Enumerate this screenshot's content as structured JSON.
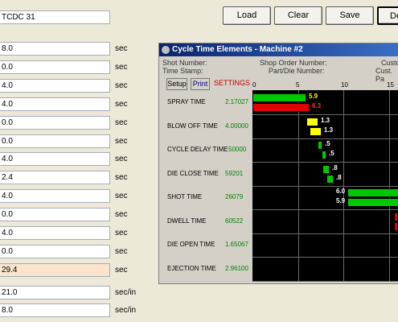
{
  "toolbar": {
    "id_value": "TCDC 31",
    "load_label": "Load",
    "clear_label": "Clear",
    "save_label": "Save",
    "partial_label": "De"
  },
  "fields": [
    {
      "value": "8.0",
      "unit": "sec"
    },
    {
      "value": "0.0",
      "unit": "sec"
    },
    {
      "value": "4.0",
      "unit": "sec"
    },
    {
      "value": "4.0",
      "unit": "sec"
    },
    {
      "value": "0.0",
      "unit": "sec"
    },
    {
      "value": "0.0",
      "unit": "sec"
    },
    {
      "value": "4.0",
      "unit": "sec"
    },
    {
      "value": "2.4",
      "unit": "sec"
    },
    {
      "value": "4.0",
      "unit": "sec"
    },
    {
      "value": "0.0",
      "unit": "sec"
    },
    {
      "value": "4.0",
      "unit": "sec"
    },
    {
      "value": "0.0",
      "unit": "sec"
    },
    {
      "value": "29.4",
      "unit": "sec"
    }
  ],
  "extra_fields": [
    {
      "value": "21.0",
      "unit": "sec/in"
    },
    {
      "value": "8.0",
      "unit": "sec/in"
    }
  ],
  "window": {
    "title": "Cycle Time Elements - Machine #2",
    "shot_number_label": "Shot Number:",
    "time_stamp_label": "Time Stamp:",
    "shop_order_label": "Shop Order Number:",
    "part_die_label": "Part/Die Number:",
    "custom_label": "Custon",
    "cust_part_label": "Cust. Pa",
    "setup_label": "Setup",
    "print_label": "Print",
    "settings_label": "SETTINGS"
  },
  "chart_data": {
    "type": "bar",
    "orientation": "horizontal-gantt",
    "x_ticks": [
      "0",
      "5",
      "10",
      "15"
    ],
    "xlim": [
      0,
      16
    ],
    "colors": {
      "green": "#00c800",
      "red": "#e00000",
      "yellow": "#ffff00"
    },
    "rows": [
      {
        "label": "SPRAY TIME",
        "value": "2.17027",
        "bars": [
          {
            "start": 0,
            "dur": 5.9,
            "color": "green",
            "label": "5.9",
            "label_color": "#ffff00"
          },
          {
            "start": 0,
            "dur": 6.3,
            "color": "red",
            "label": "6.3",
            "label_color": "#ff3030"
          }
        ]
      },
      {
        "label": "BLOW OFF TIME",
        "value": "4.00000",
        "bars": [
          {
            "start": 5.9,
            "dur": 1.3,
            "color": "yellow",
            "label": "1.3",
            "label_color": "#ffffff"
          },
          {
            "start": 6.3,
            "dur": 1.3,
            "color": "yellow",
            "label": "1.3",
            "label_color": "#ffffff"
          }
        ]
      },
      {
        "label": "CYCLE DELAY TIME",
        "value": "50000",
        "bars": [
          {
            "start": 7.2,
            "dur": 0.5,
            "color": "green",
            "label": ".5",
            "label_color": "#ffffff"
          },
          {
            "start": 7.6,
            "dur": 0.5,
            "color": "green",
            "label": ".5",
            "label_color": "#ffffff"
          }
        ]
      },
      {
        "label": "DIE CLOSE TIME",
        "value": "59201",
        "bars": [
          {
            "start": 7.7,
            "dur": 0.8,
            "color": "green",
            "label": ".8",
            "label_color": "#ffffff"
          },
          {
            "start": 8.1,
            "dur": 0.8,
            "color": "green",
            "label": ".8",
            "label_color": "#ffffff"
          }
        ]
      },
      {
        "label": "SHOT TIME",
        "value": "26079",
        "bars": [
          {
            "start": 10.4,
            "dur": 6.0,
            "color": "green",
            "label": "6.0",
            "label_color": "#ffffff"
          },
          {
            "start": 10.4,
            "dur": 6.0,
            "color": "green",
            "label": "5.9",
            "label_color": "#ffffff"
          }
        ]
      },
      {
        "label": "DWELL TIME",
        "value": "60522",
        "bars": [
          {
            "start": 15.6,
            "dur": 0.4,
            "color": "red",
            "label": "",
            "label_color": "#ff3030"
          },
          {
            "start": 15.6,
            "dur": 0.4,
            "color": "red",
            "label": "",
            "label_color": "#ff3030"
          }
        ]
      },
      {
        "label": "DIE OPEN TIME",
        "value": "1.65067",
        "bars": []
      },
      {
        "label": "EJECTION TIME",
        "value": "2.96100",
        "bars": []
      }
    ]
  }
}
